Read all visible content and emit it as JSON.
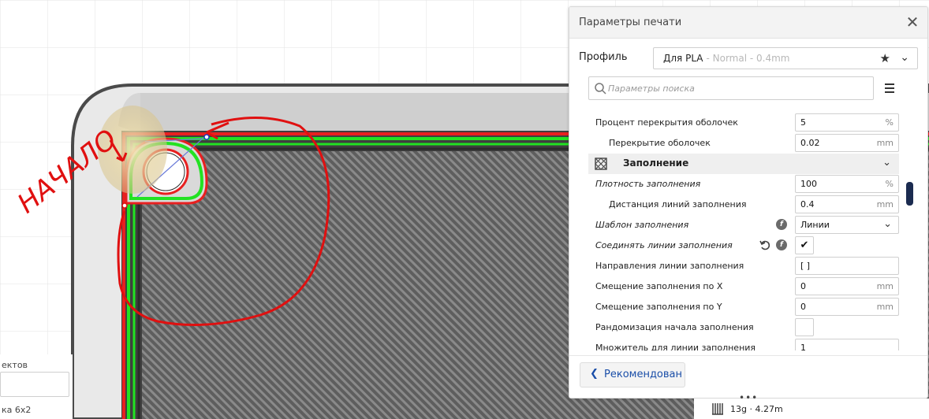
{
  "viewport": {
    "annotation_text": "НАЧАЛО",
    "colors": {
      "background": "#ffffff",
      "grid": "#e3e3e3",
      "plate_border": "#555555",
      "plate_fill": "#c9c9c9",
      "model_fill": "#616161",
      "infill_line": "#7a7a7a",
      "wall_outer": "#e82020",
      "wall_inner": "#22e222",
      "annotation": "#e01010"
    }
  },
  "left_panel": {
    "label": "ектов",
    "object_name": "ка 6x2"
  },
  "panel": {
    "title": "Параметры печати",
    "close_icon": "close-icon",
    "profile": {
      "label": "Профиль",
      "name": "Для PLA",
      "meta": "- Normal - 0.4mm"
    },
    "search": {
      "placeholder": "Параметры поиска",
      "value": ""
    },
    "settings": [
      {
        "label": "Процент перекрытия оболочек",
        "value": "5",
        "unit": "%",
        "indent": 1
      },
      {
        "label": "Перекрытие оболочек",
        "value": "0.02",
        "unit": "mm",
        "indent": 2
      },
      {
        "category": "Заполнение",
        "icon": "infill-icon"
      },
      {
        "label": "Плотность заполнения",
        "value": "100",
        "unit": "%",
        "indent": 1,
        "italic": true
      },
      {
        "label": "Дистанция линий заполнения",
        "value": "0.4",
        "unit": "mm",
        "indent": 2
      },
      {
        "label": "Шаблон заполнения",
        "value": "Линии",
        "type": "dropdown",
        "indent": 1,
        "italic": true,
        "f_icon": "f"
      },
      {
        "label": "Соединять линии заполнения",
        "value": "✔",
        "type": "checkbox",
        "indent": 1,
        "italic": true,
        "f_icon": "f",
        "reset": true
      },
      {
        "label": "Направления линии заполнения",
        "value": "[ ]",
        "unit": "",
        "indent": 1
      },
      {
        "label": "Смещение заполнения по X",
        "value": "0",
        "unit": "mm",
        "indent": 1
      },
      {
        "label": "Смещение заполнения по Y",
        "value": "0",
        "unit": "mm",
        "indent": 1
      },
      {
        "label": "Рандомизация начала заполнения",
        "value": "",
        "type": "checkbox",
        "indent": 1
      },
      {
        "label": "Множитель для линии заполнения",
        "value": "1",
        "unit": "",
        "indent": 1
      }
    ],
    "footer": {
      "recommended_label": "Рекомендован"
    }
  },
  "bottom_info": {
    "text": "13g · 4.27m"
  }
}
